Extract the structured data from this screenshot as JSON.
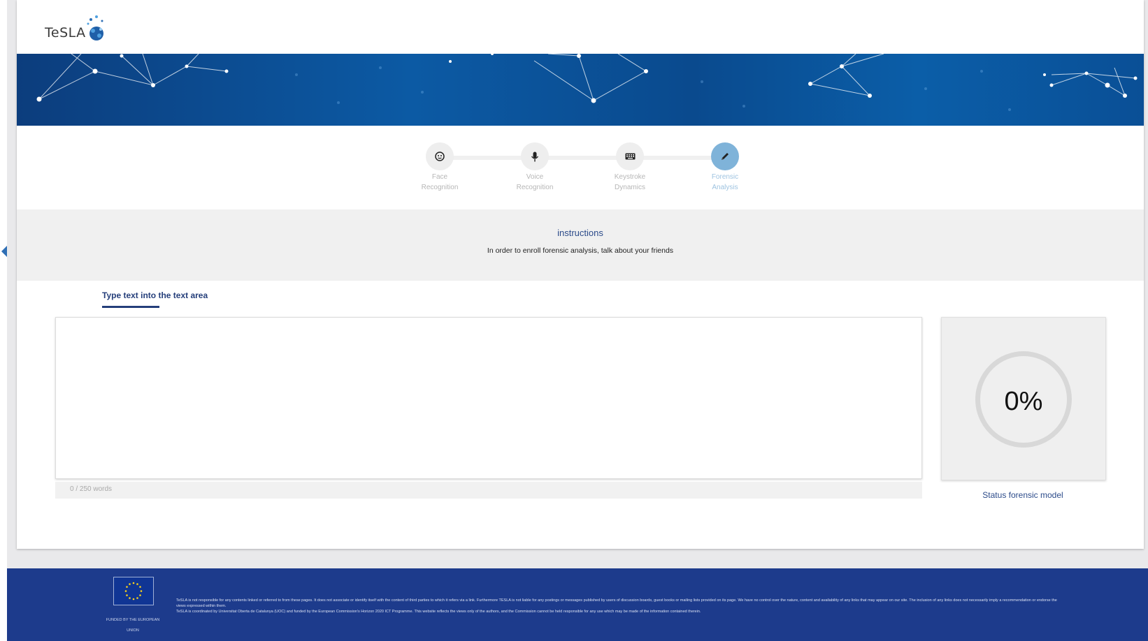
{
  "app": {
    "logo_text": "TeSLA"
  },
  "steps": [
    {
      "label_line1": "Face",
      "label_line2": "Recognition",
      "icon": "face-icon",
      "active": false
    },
    {
      "label_line1": "Voice",
      "label_line2": "Recognition",
      "icon": "microphone-icon",
      "active": false
    },
    {
      "label_line1": "Keystroke",
      "label_line2": "Dynamics",
      "icon": "keyboard-icon",
      "active": false
    },
    {
      "label_line1": "Forensic",
      "label_line2": "Analysis",
      "icon": "pencil-icon",
      "active": true
    }
  ],
  "instructions": {
    "title": "instructions",
    "text": "In order to enroll forensic analysis, talk about your friends"
  },
  "editor": {
    "tab_label": "Type text into the text area",
    "value": "",
    "word_count": "0 / 250 words"
  },
  "status": {
    "percent_text": "0%",
    "percent_value": 0,
    "label": "Status forensic model"
  },
  "footer": {
    "eu_caption_line1": "FUNDED BY THE EUROPEAN",
    "eu_caption_line2": "UNION",
    "disclaimer_1": "TeSLA is not responsible for any contents linked or referred to from these pages. It does not associate or identify itself with the content of third parties to which it refers via a link. Furthermore TESLA is not liable for any postings or messages published by users of discussion boards, guest books or mailing lists provided on its page. We have no control over the nature, content and availability of any links that may appear on our site. The inclusion of any links does not necessarily imply a recommendation or endorse the views expressed within them.",
    "disclaimer_2": "TeSLA is coordinated by Universitat Oberta de Catalunya (UOC) and funded by the European Commission's Horizon 2020 ICT Programme. This website reflects the views only of the authors, and the Commission cannot be held responsible for any use which may be made of the information contained therein."
  },
  "colors": {
    "brand_dark_blue": "#1d3b8c",
    "accent_blue": "#2c4b8a",
    "active_step": "#7fb3d9"
  }
}
